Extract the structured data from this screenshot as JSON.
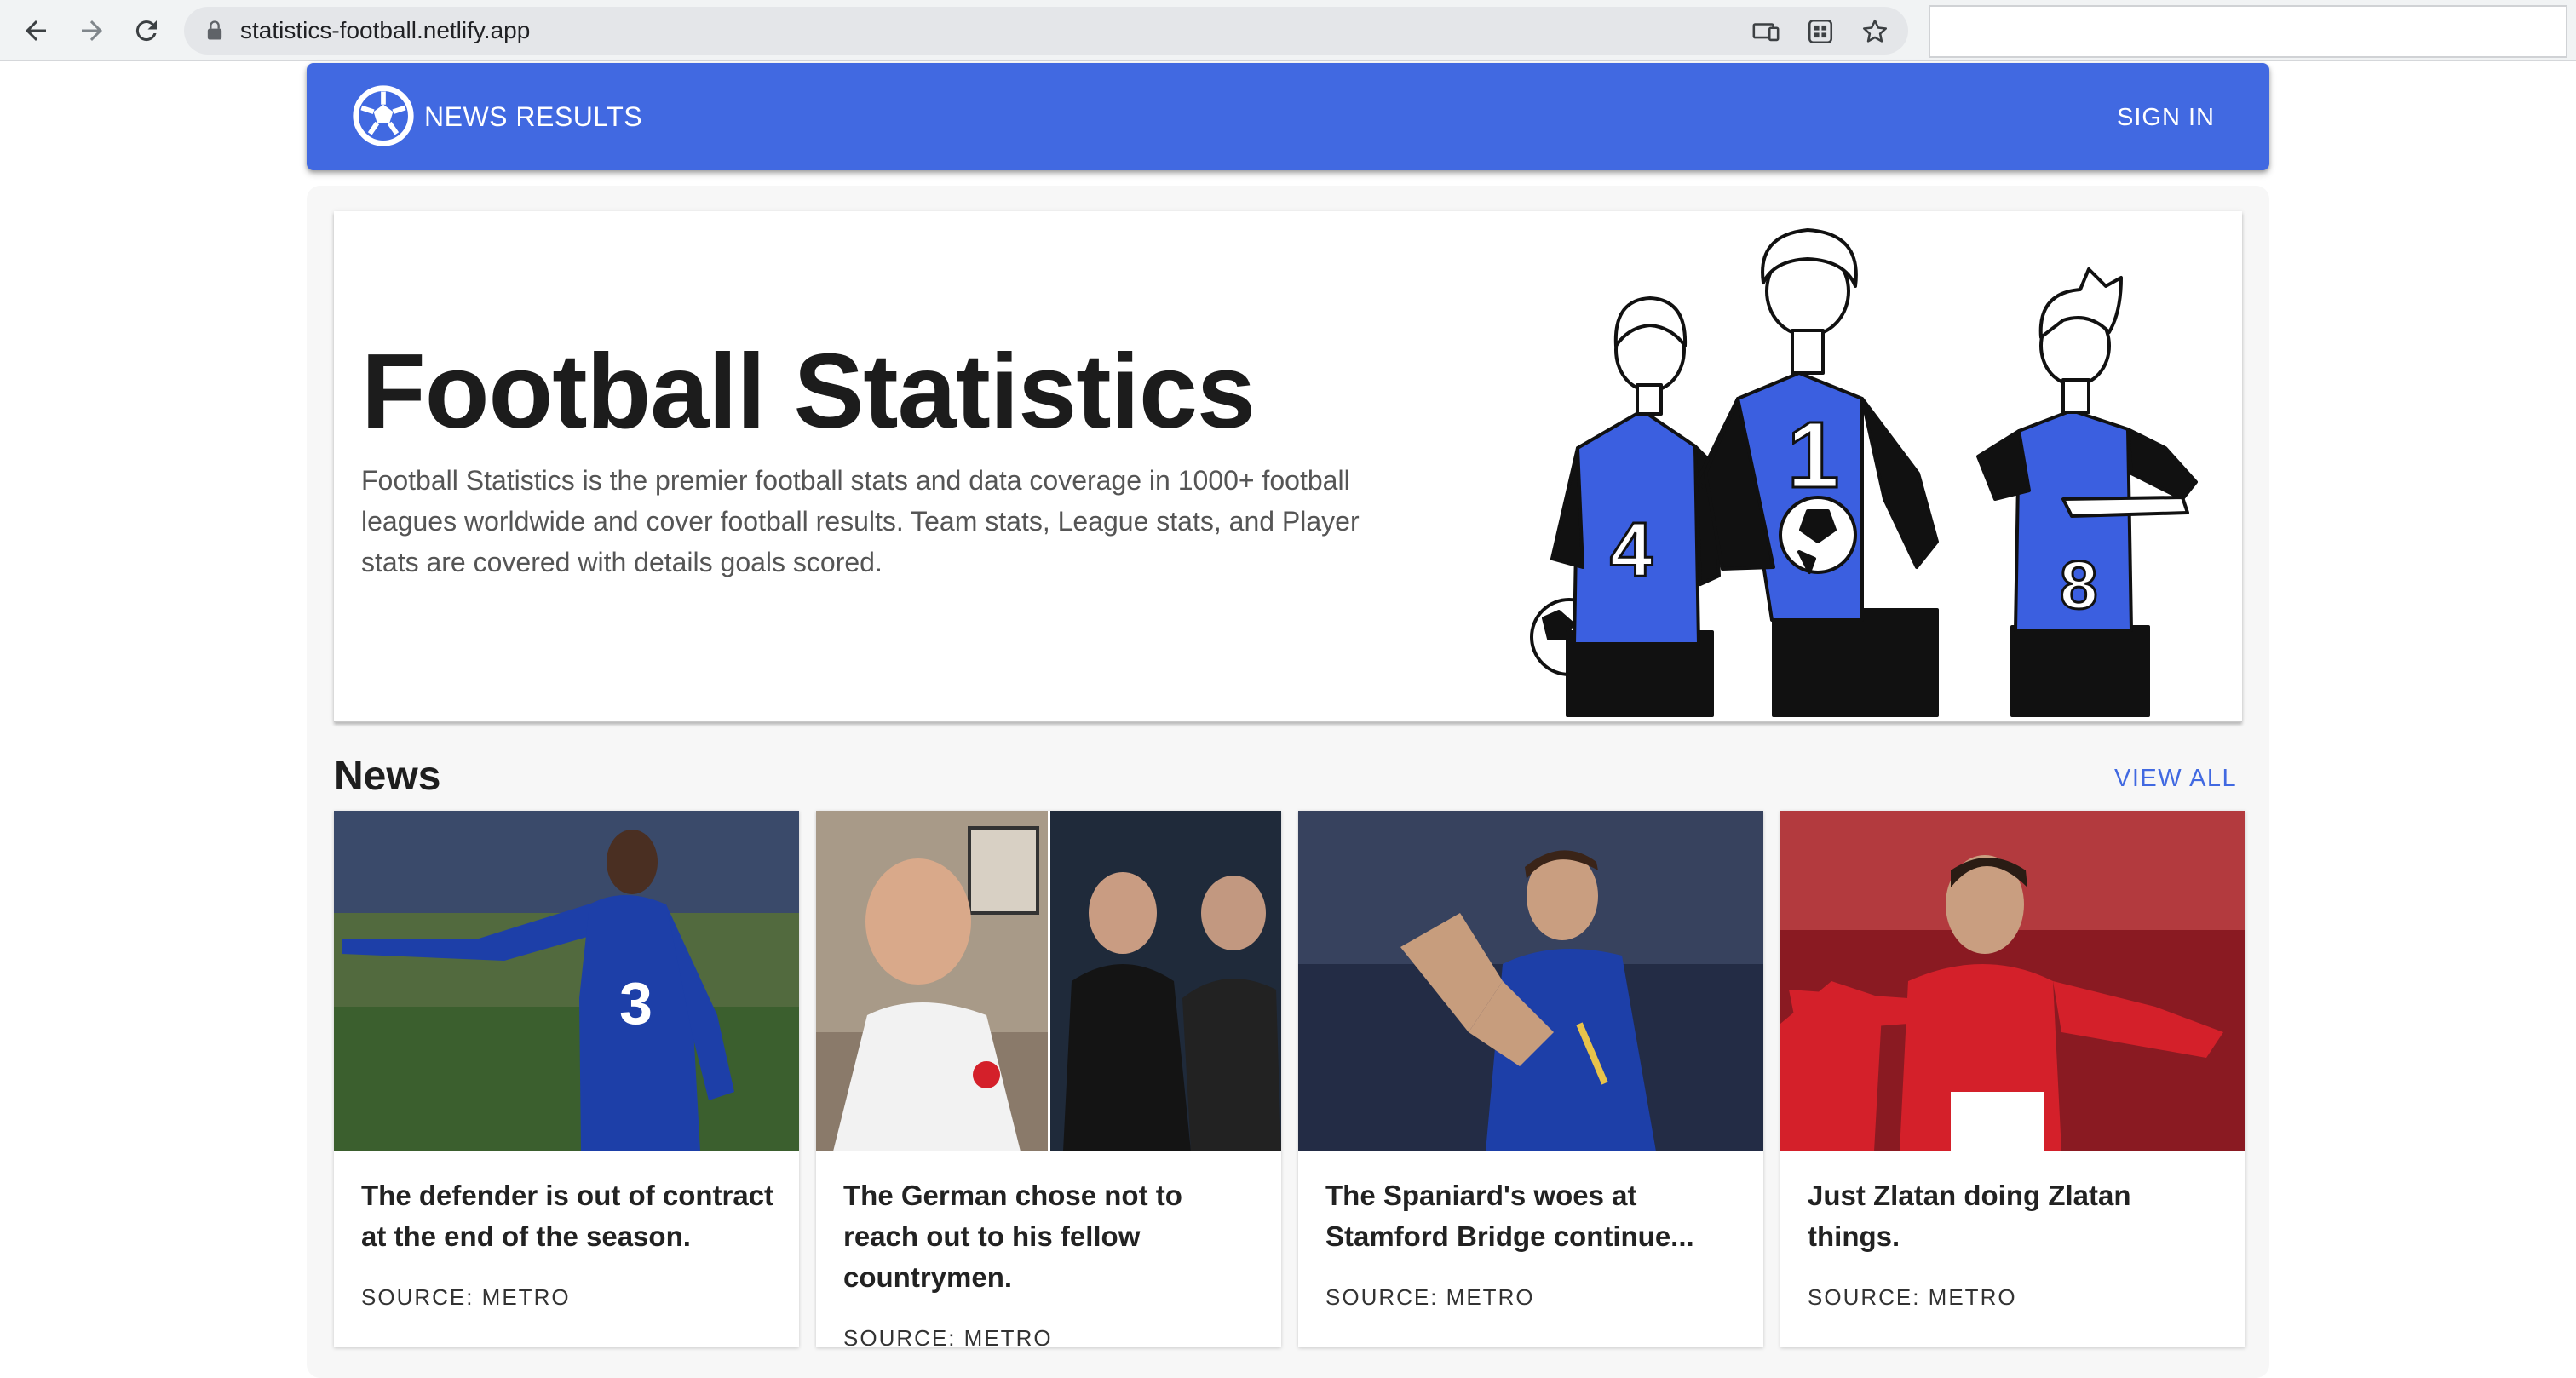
{
  "browser": {
    "url": "statistics-football.netlify.app"
  },
  "header": {
    "brand": "NEWS RESULTS",
    "sign_in": "SIGN IN"
  },
  "hero": {
    "title": "Football Statistics",
    "description": "Football Statistics is the premier football stats and data coverage in 1000+ football leagues worldwide and cover football results. Team stats, League stats, and Player stats are covered with details goals scored.",
    "jersey_numbers": [
      "4",
      "1",
      "8"
    ]
  },
  "news": {
    "title": "News",
    "view_all": "VIEW ALL",
    "cards": [
      {
        "headline": "The defender is out of contract at the end of the season.",
        "source": "SOURCE: METRO"
      },
      {
        "headline": "The German chose not to reach out to his fellow countrymen.",
        "source": "SOURCE: METRO"
      },
      {
        "headline": "The Spaniard's woes at Stamford Bridge continue...",
        "source": "SOURCE: METRO"
      },
      {
        "headline": "Just Zlatan doing Zlatan things.",
        "source": "SOURCE: METRO"
      }
    ]
  },
  "colors": {
    "primary": "#4169e1",
    "chelsea_blue": "#1d3fa8",
    "united_red": "#d4202a"
  }
}
